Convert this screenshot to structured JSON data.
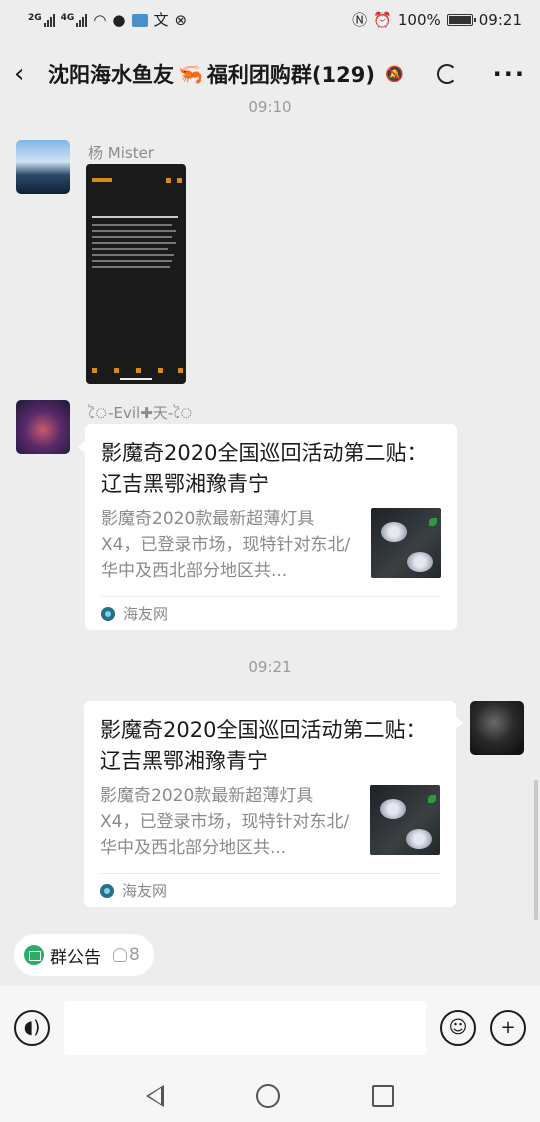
{
  "status_bar": {
    "sim1": "2G",
    "sim2": "4G",
    "battery": "100%",
    "battery_fill": 1.0,
    "time": "09:21"
  },
  "header": {
    "title_part1": "沈阳海水鱼友",
    "title_part2": "福利团购群(129)",
    "back_icon": "chevron-left-icon",
    "more_icon": "ellipsis-icon"
  },
  "messages": [
    {
      "type": "time",
      "text": "09:10"
    },
    {
      "type": "image",
      "sender": "杨 Mister",
      "side": "left"
    },
    {
      "type": "link",
      "sender": "ৈ-Evil✚天-ৈ",
      "side": "left",
      "title": "影魔奇2020全国巡回活动第二贴： 辽吉黑鄂湘豫青宁",
      "desc": "影魔奇2020款最新超薄灯具X4，已登录市场，现特针对东北/华中及西北部分地区共...",
      "source": "海友网"
    },
    {
      "type": "time",
      "text": "09:21"
    },
    {
      "type": "link",
      "side": "right",
      "title": "影魔奇2020全国巡回活动第二贴： 辽吉黑鄂湘豫青宁",
      "desc": "影魔奇2020款最新超薄灯具X4，已登录市场，现特针对东北/华中及西北部分地区共...",
      "source": "海友网"
    }
  ],
  "announcement": {
    "label": "群公告",
    "count": "8"
  },
  "input": {
    "placeholder": ""
  },
  "colors": {
    "background": "#ededed",
    "card": "#ffffff",
    "accent_green": "#2aae67"
  }
}
